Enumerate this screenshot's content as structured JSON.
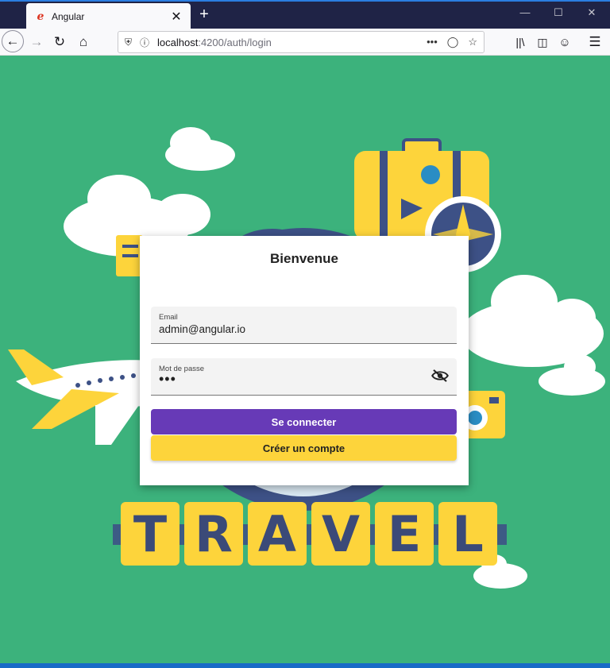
{
  "browser": {
    "tab": {
      "title": "Angular",
      "favicon": "angular-favicon",
      "close": "✕"
    },
    "new_tab": "+",
    "url": {
      "host": "localhost",
      "path": ":4200/auth/login"
    }
  },
  "illustration": {
    "word_letters": [
      "T",
      "R",
      "A",
      "V",
      "E",
      "L"
    ],
    "colors": {
      "background": "#3cb27c",
      "tiles": "#fdd43b",
      "letters": "#3b4a78",
      "globe": "#3d5186",
      "clouds": "#ffffff"
    }
  },
  "login": {
    "title": "Bienvenue",
    "email_label": "Email",
    "email_value": "admin@angular.io",
    "password_label": "Mot de passe",
    "password_value": "•••",
    "submit_label": "Se connecter",
    "register_label": "Créer un compte"
  },
  "colors": {
    "primary": "#673ab7",
    "accent": "#fdd43b"
  }
}
